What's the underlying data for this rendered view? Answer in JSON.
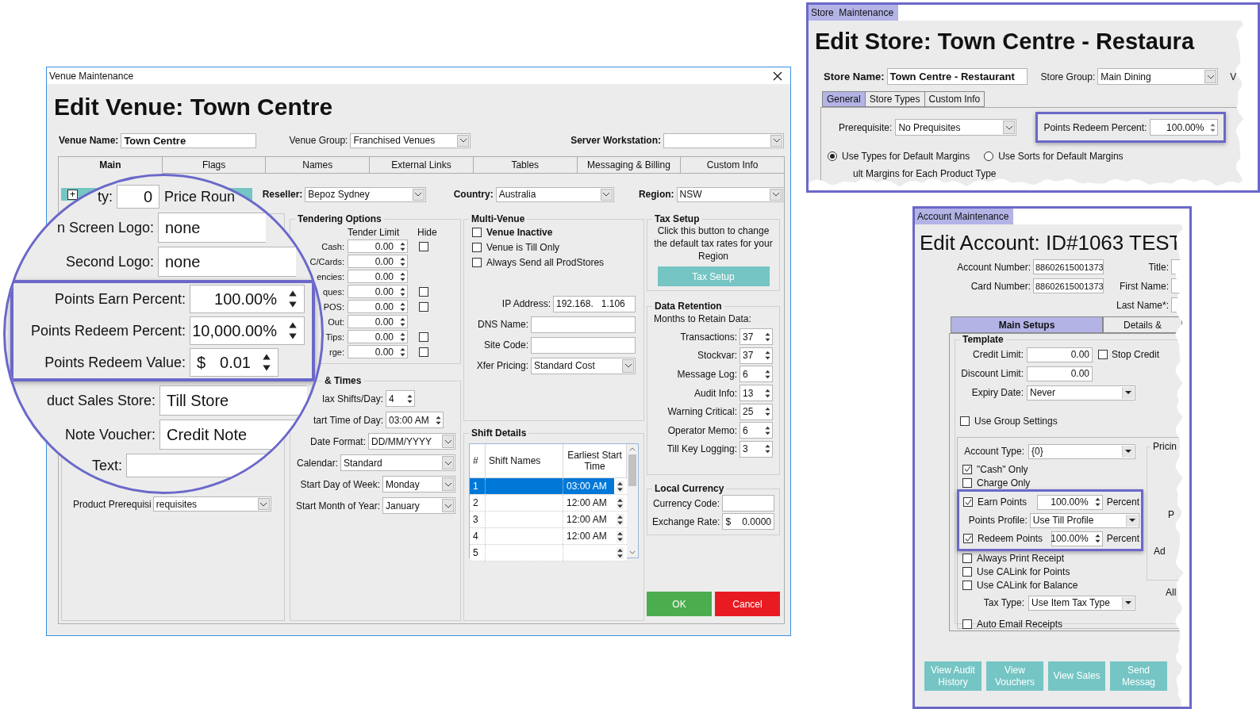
{
  "venue": {
    "title": "Venue Maintenance",
    "heading": "Edit Venue: Town Centre",
    "venue_name": {
      "label": "Venue Name:",
      "value": "Town Centre"
    },
    "venue_group": {
      "label": "Venue Group:",
      "value": "Franchised Venues"
    },
    "server_workstation": {
      "label": "Server Workstation:"
    },
    "tabs": [
      {
        "label": "Main",
        "selected": true
      },
      {
        "label": "Flags",
        "selected": false
      },
      {
        "label": "Names",
        "selected": false
      },
      {
        "label": "External Links",
        "selected": false
      },
      {
        "label": "Tables",
        "selected": false
      },
      {
        "label": "Messaging & Billing",
        "selected": false
      },
      {
        "label": "Custom Info",
        "selected": false
      }
    ],
    "expand_button": "+",
    "selectors": [
      {
        "label": "Reseller:",
        "value": "Bepoz Sydney"
      },
      {
        "label": "Country:",
        "value": "Australia"
      },
      {
        "label": "Region:",
        "value": "NSW"
      }
    ],
    "magnifier": {
      "qty": {
        "label": "ty:",
        "value": "0"
      },
      "price_round": "Price Roun",
      "logos": [
        {
          "label": "n Screen Logo:",
          "value": "none"
        },
        {
          "label": "Second Logo:",
          "value": "none"
        }
      ],
      "points": [
        {
          "label": "Points Earn Percent:",
          "value": "100.00%"
        },
        {
          "label": "Points Redeem Percent:",
          "value": "10,000.00%"
        },
        {
          "label": "Points Redeem Value:",
          "prefix": "$",
          "value": "0.01"
        }
      ],
      "stores": [
        {
          "label": "duct Sales Store:",
          "value": "Till Store"
        },
        {
          "label": "Note Voucher:",
          "value": "Credit Note"
        }
      ],
      "text": {
        "label": "Text:"
      }
    },
    "product_prerequisite": {
      "label": "Product Prerequisi",
      "value": "requisites"
    },
    "tendering": {
      "title": "Tendering Options",
      "columns": [
        "Tender Limit",
        "Hide"
      ],
      "rows": [
        {
          "label": "Cash:",
          "value": "0.00",
          "hide": false
        },
        {
          "label": "C/Cards:",
          "value": "0.00"
        },
        {
          "label": "encies:",
          "value": "0.00"
        },
        {
          "label": "ques:",
          "value": "0.00",
          "hide": false
        },
        {
          "label": "POS:",
          "value": "0.00",
          "hide": false
        },
        {
          "label": "Out:",
          "value": "0.00"
        },
        {
          "label": "Tips:",
          "value": "0.00",
          "hide": false
        },
        {
          "label": "rge:",
          "value": "0.00",
          "hide": false
        }
      ]
    },
    "times": {
      "title": "& Times",
      "rows": [
        {
          "kind": "spin",
          "label": "lax Shifts/Day:",
          "value": "4"
        },
        {
          "kind": "spin",
          "label": "tart Time of Day:",
          "value": "03:00 AM"
        },
        {
          "kind": "dropdown",
          "label": "Date Format:",
          "value": "DD/MM/YYYY"
        },
        {
          "kind": "dropdown",
          "label": "Calendar:",
          "value": "Standard"
        },
        {
          "kind": "dropdown",
          "label": "Start Day of Week:",
          "value": "Monday"
        },
        {
          "kind": "dropdown",
          "label": "Start Month of Year:",
          "value": "January"
        }
      ]
    },
    "multi_venue": {
      "title": "Multi-Venue",
      "checks": [
        {
          "label": "Venue Inactive",
          "checked": false,
          "bold": true
        },
        {
          "label": "Venue is Till Only",
          "checked": false,
          "bold": false
        },
        {
          "label": "Always Send all ProdStores",
          "checked": false,
          "bold": false
        }
      ],
      "fields": [
        {
          "kind": "text",
          "label": "IP Address:",
          "value": "192.168.   1.106"
        },
        {
          "kind": "text",
          "label": "DNS Name:"
        },
        {
          "kind": "text",
          "label": "Site Code:"
        },
        {
          "kind": "dropdown",
          "label": "Xfer Pricing:",
          "value": "Standard Cost"
        }
      ]
    },
    "shift_details": {
      "title": "Shift Details",
      "columns": [
        "#",
        "Shift Names",
        "Earliest Start Time"
      ],
      "rows": [
        {
          "number": "1",
          "time": "03:00 AM",
          "selected": true
        },
        {
          "number": "2",
          "time": "12:00 AM",
          "selected": false
        },
        {
          "number": "3",
          "time": "12:00 AM",
          "selected": false
        },
        {
          "number": "4",
          "time": "12:00 AM",
          "selected": false
        },
        {
          "number": "5",
          "selected": false
        }
      ]
    },
    "tax_setup": {
      "title": "Tax Setup",
      "text": "Click this button to change the default tax rates for your Region",
      "button": "Tax Setup"
    },
    "data_retention": {
      "title": "Data Retention",
      "subtitle": "Months to Retain Data:",
      "rows": [
        {
          "label": "Transactions:",
          "value": "37"
        },
        {
          "label": "Stockvar:",
          "value": "37"
        },
        {
          "label": "Message Log:",
          "value": "6"
        },
        {
          "label": "Audit Info:",
          "value": "13"
        },
        {
          "label": "Warning Critical:",
          "value": "25"
        },
        {
          "label": "Operator Memo:",
          "value": "6"
        },
        {
          "label": "Till Key Logging:",
          "value": "3"
        }
      ]
    },
    "local_currency": {
      "title": "Local Currency",
      "fields": [
        {
          "label": "Currency Code:"
        },
        {
          "label": "Exchange Rate:",
          "prefix": "$",
          "value": "0.0000"
        }
      ]
    },
    "buttons": [
      {
        "label": "OK",
        "kind": "ok"
      },
      {
        "label": "Cancel",
        "kind": "cancel"
      }
    ]
  },
  "store": {
    "title": "Store  Maintenance",
    "heading": "Edit Store: Town Centre - Restaura",
    "store_name": {
      "label": "Store Name:",
      "value": "Town Centre - Restaurant"
    },
    "store_group": {
      "label": "Store Group:",
      "value": "Main Dining"
    },
    "cut_label": "V",
    "tabs": [
      {
        "label": "General",
        "selected": true
      },
      {
        "label": "Store Types",
        "selected": false
      },
      {
        "label": "Custom Info",
        "selected": false
      }
    ],
    "prerequisite": {
      "label": "Prerequisite:",
      "value": "No Prequisites"
    },
    "points_redeem": {
      "label": "Points Redeem Percent:",
      "value": "100.00%"
    },
    "radios": [
      {
        "label": "Use Types for Default Margins",
        "selected": true
      },
      {
        "label": "Use Sorts for Default Margins",
        "selected": false
      }
    ],
    "section_label": "ult Margins for Each Product Type"
  },
  "account": {
    "title": "Account Maintenance",
    "heading": "Edit Account: ID#1063 TEST",
    "numbers": [
      {
        "label": "Account Number:",
        "value": "88602615001373"
      },
      {
        "label": "Card Number:",
        "value": "88602615001373"
      }
    ],
    "names": [
      {
        "label": "Title:"
      },
      {
        "label": "First Name:"
      },
      {
        "label": "Last Name*:"
      }
    ],
    "tabs": [
      {
        "label": "Main Setups",
        "selected": true
      },
      {
        "label": "Details &",
        "selected": false
      }
    ],
    "template": {
      "title": "Template",
      "credit_limit": {
        "label": "Credit Limit:",
        "value": "0.00"
      },
      "stop_credit": {
        "label": "Stop Credit",
        "checked": false
      },
      "discount_limit": {
        "label": "Discount Limit:",
        "value": "0.00"
      },
      "expiry_date": {
        "label": "Expiry Date:",
        "value": "Never"
      },
      "use_group_settings": {
        "label": "Use Group Settings",
        "checked": false
      }
    },
    "settings": [
      {
        "kind": "dropdown",
        "label": "Account Type:",
        "value": "{0}"
      },
      {
        "kind": "check",
        "label": "\"Cash\" Only",
        "checked": true
      },
      {
        "kind": "check",
        "label": "Charge Only",
        "checked": false
      }
    ],
    "points": [
      {
        "kind": "check_percent",
        "label": "Earn Points",
        "checked": true,
        "value": "100.00%",
        "unit": "Percent"
      },
      {
        "kind": "dropdown",
        "label": "Points Profile:",
        "value": "Use Till Profile"
      },
      {
        "kind": "check_percent",
        "label": "Redeem Points",
        "checked": true,
        "value": "100.00%",
        "unit": "Percent"
      }
    ],
    "options": [
      {
        "kind": "check",
        "label": "Always Print Receipt",
        "checked": false
      },
      {
        "kind": "check",
        "label": "Use CALink for Points",
        "checked": false
      },
      {
        "kind": "check",
        "label": "Use CALink for Balance",
        "checked": false
      },
      {
        "kind": "dropdown",
        "label": "Tax Type:",
        "value": "Use Item Tax Type"
      },
      {
        "kind": "check",
        "label": "Auto Email Receipts",
        "checked": false
      }
    ],
    "pricing": {
      "title": "Pricin",
      "labels": [
        "P",
        "Ad"
      ]
    },
    "side_label": "All",
    "buttons": [
      "View Audit History",
      "View Vouchers",
      "View Sales",
      "Send Messag"
    ]
  }
}
